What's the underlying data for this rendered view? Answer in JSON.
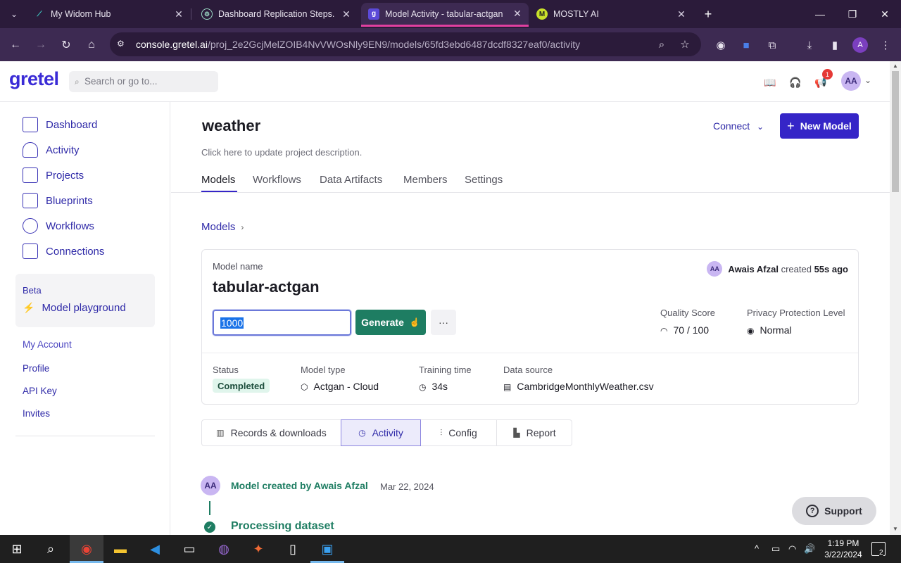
{
  "browser": {
    "tabs": [
      {
        "title": "My Widom Hub",
        "favicon": "widom-icon",
        "active": false
      },
      {
        "title": "Dashboard Replication Steps.",
        "favicon": "openai-icon",
        "active": false
      },
      {
        "title": "Model Activity - tabular-actgan",
        "favicon": "gretel-icon",
        "active": true
      },
      {
        "title": "MOSTLY AI",
        "favicon": "mostly-icon",
        "active": false
      }
    ],
    "favicon_letters": {
      "gretel": "g",
      "mostly": "M"
    },
    "url_host": "console.gretel.ai",
    "url_path": "/proj_2e2GcjMelZOIB4NvVWOsNly9EN9/models/65fd3ebd6487dcdf8327eaf0/activity",
    "profile_initial": "A"
  },
  "app": {
    "logo": "gretel",
    "search_placeholder": "Search or go to...",
    "notification_count": "1",
    "user_initials": "AA"
  },
  "sidebar": {
    "items": [
      {
        "label": "Dashboard",
        "icon": "dashboard-icon"
      },
      {
        "label": "Activity",
        "icon": "activity-icon"
      },
      {
        "label": "Projects",
        "icon": "folder-icon"
      },
      {
        "label": "Blueprints",
        "icon": "blueprint-icon"
      },
      {
        "label": "Workflows",
        "icon": "workflow-icon"
      },
      {
        "label": "Connections",
        "icon": "connection-icon"
      }
    ],
    "beta_label": "Beta",
    "beta_item": "Model playground",
    "account_header": "My Account",
    "account_links": [
      "Profile",
      "API Key",
      "Invites"
    ]
  },
  "project": {
    "title": "weather",
    "description": "Click here to update project description.",
    "connect_label": "Connect",
    "new_model_label": "New Model",
    "tabs": [
      "Models",
      "Workflows",
      "Data Artifacts",
      "Members",
      "Settings"
    ],
    "active_tab": "Models"
  },
  "breadcrumb": "Models",
  "model": {
    "name_label": "Model name",
    "name": "tabular-actgan",
    "creator_initials": "AA",
    "creator_name": "Awais Afzal",
    "created_word": "created",
    "created_ago": "55s ago",
    "records_value": "1000",
    "generate_label": "Generate",
    "more_label": "···",
    "quality_score_label": "Quality Score",
    "quality_score_value": "70 / 100",
    "privacy_label": "Privacy Protection Level",
    "privacy_value": "Normal",
    "status_label": "Status",
    "status_value": "Completed",
    "model_type_label": "Model type",
    "model_type_value": "Actgan - Cloud",
    "training_time_label": "Training time",
    "training_time_value": "34s",
    "data_source_label": "Data source",
    "data_source_value": "CambridgeMonthlyWeather.csv"
  },
  "subtabs": [
    "Records & downloads",
    "Activity",
    "Config",
    "Report"
  ],
  "active_subtab": "Activity",
  "activity": {
    "avatar": "AA",
    "created_text": "Model created by Awais Afzal",
    "created_date": "Mar 22, 2024",
    "processing_text": "Processing dataset"
  },
  "support_label": "Support",
  "taskbar": {
    "time": "1:19 PM",
    "date": "3/22/2024",
    "notification_count": "2"
  },
  "colors": {
    "brand": "#3525c7",
    "accent_green": "#1e7d62",
    "tab_strip": "#2b1b3a"
  }
}
